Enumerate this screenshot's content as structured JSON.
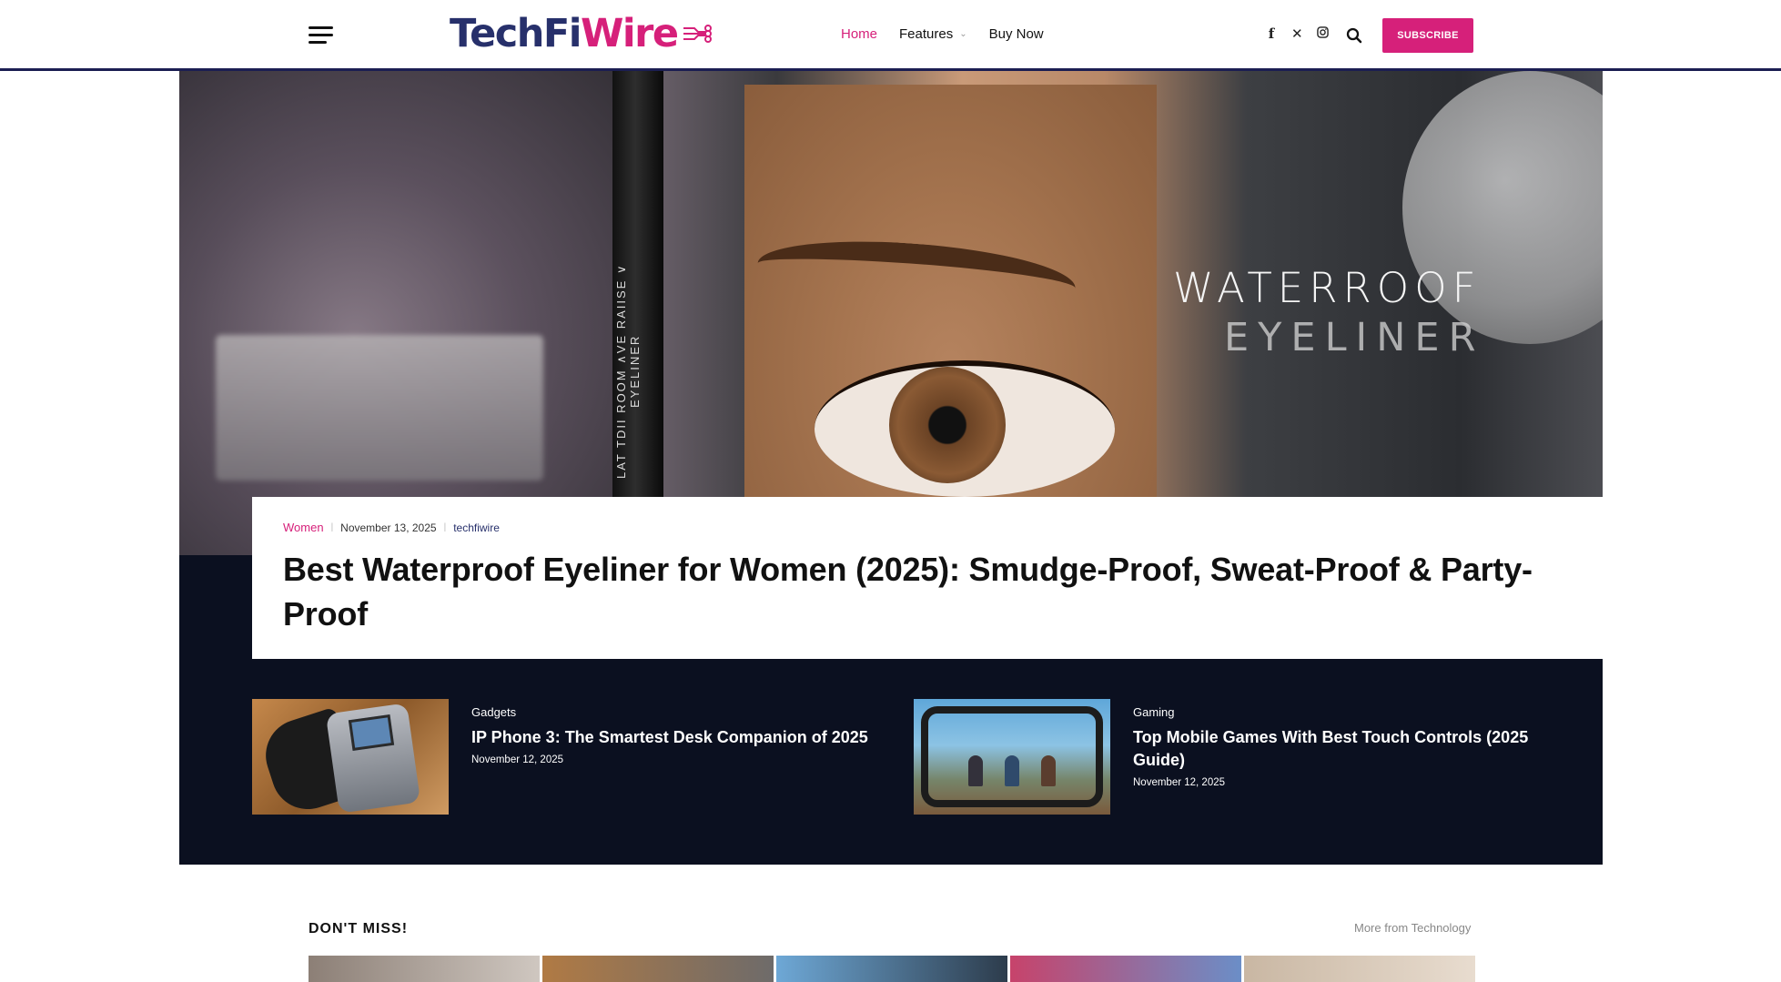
{
  "header": {
    "logo_part1": "TechFi",
    "logo_part2": "Wire",
    "nav": [
      {
        "label": "Home",
        "active": true
      },
      {
        "label": "Features",
        "has_dropdown": true
      },
      {
        "label": "Buy Now"
      }
    ],
    "social_icons": [
      "facebook-icon",
      "x-icon",
      "instagram-icon"
    ],
    "subscribe_label": "SUBSCRIBE",
    "accent_color": "#d6207a",
    "brand_color": "#27306b"
  },
  "hero": {
    "image_text_line1": "WATERROOF",
    "image_text_line2": "EYELINER",
    "pencil_text": "LAT TDII ROOM ∧VE RAIISE ∨ EYELINER",
    "category": "Women",
    "date": "November 13, 2025",
    "author": "techfiwire",
    "title": "Best Waterproof Eyeliner for Women (2025): Smudge-Proof, Sweat-Proof & Party-Proof"
  },
  "sub_posts": [
    {
      "category": "Gadgets",
      "title": "IP Phone 3: The Smartest Desk Companion of 2025",
      "date": "November 12, 2025"
    },
    {
      "category": "Gaming",
      "title": "Top Mobile Games With Best Touch Controls (2025 Guide)",
      "date": "November 12, 2025"
    }
  ],
  "dont_miss": {
    "heading": "DON'T MISS!",
    "more_link": "More from Technology"
  }
}
